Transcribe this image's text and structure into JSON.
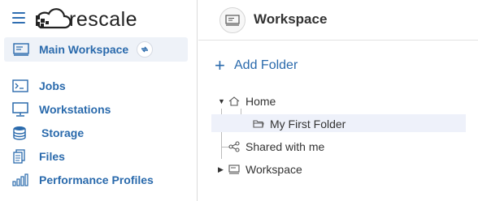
{
  "app": {
    "logo_text": "rescale"
  },
  "sidebar": {
    "workspace": {
      "label": "Main Workspace"
    },
    "items": [
      {
        "label": "Jobs",
        "icon": "terminal-icon"
      },
      {
        "label": "Workstations",
        "icon": "monitor-icon"
      },
      {
        "label": "Storage",
        "icon": "database-icon"
      },
      {
        "label": "Files",
        "icon": "files-icon"
      },
      {
        "label": "Performance Profiles",
        "icon": "bar-chart-icon"
      }
    ]
  },
  "main": {
    "title": "Workspace",
    "add_folder_label": "Add Folder",
    "tree": [
      {
        "label": "Home",
        "icon": "home-icon",
        "expanded": true
      },
      {
        "label": "My First Folder",
        "icon": "folder-open-icon",
        "selected": true
      },
      {
        "label": "Shared with me",
        "icon": "share-icon"
      },
      {
        "label": "Workspace",
        "icon": "workspace-icon",
        "expanded": false
      }
    ]
  },
  "colors": {
    "accent": "#2a6aac",
    "selected_row": "#eef1fa",
    "sidebar_active": "#eef2f8"
  }
}
